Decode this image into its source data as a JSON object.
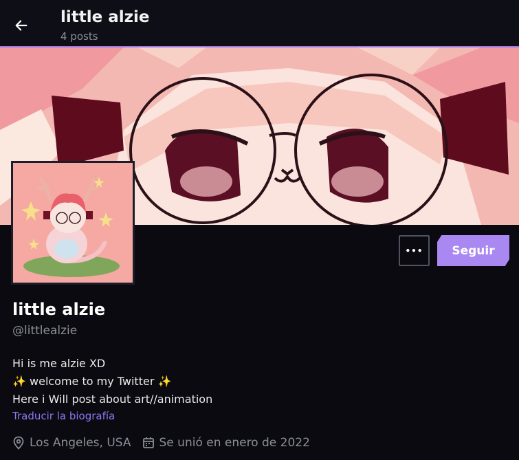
{
  "header": {
    "title": "little alzie",
    "post_count": "4 posts"
  },
  "profile": {
    "display_name": "little alzie",
    "handle": "@littlealzie",
    "bio_lines": [
      "Hi is me alzie XD",
      "✨ welcome to my Twitter ✨",
      "Here i Will post about art//animation"
    ],
    "translate_label": "Traducir la biografía",
    "location": "Los Angeles, USA",
    "joined": "Se unió en enero de 2022"
  },
  "actions": {
    "more_label": "•••",
    "follow_label": "Seguir"
  },
  "colors": {
    "accent": "#a988f2",
    "link": "#8a79f4",
    "banner_bg": "#f4b8b2"
  }
}
